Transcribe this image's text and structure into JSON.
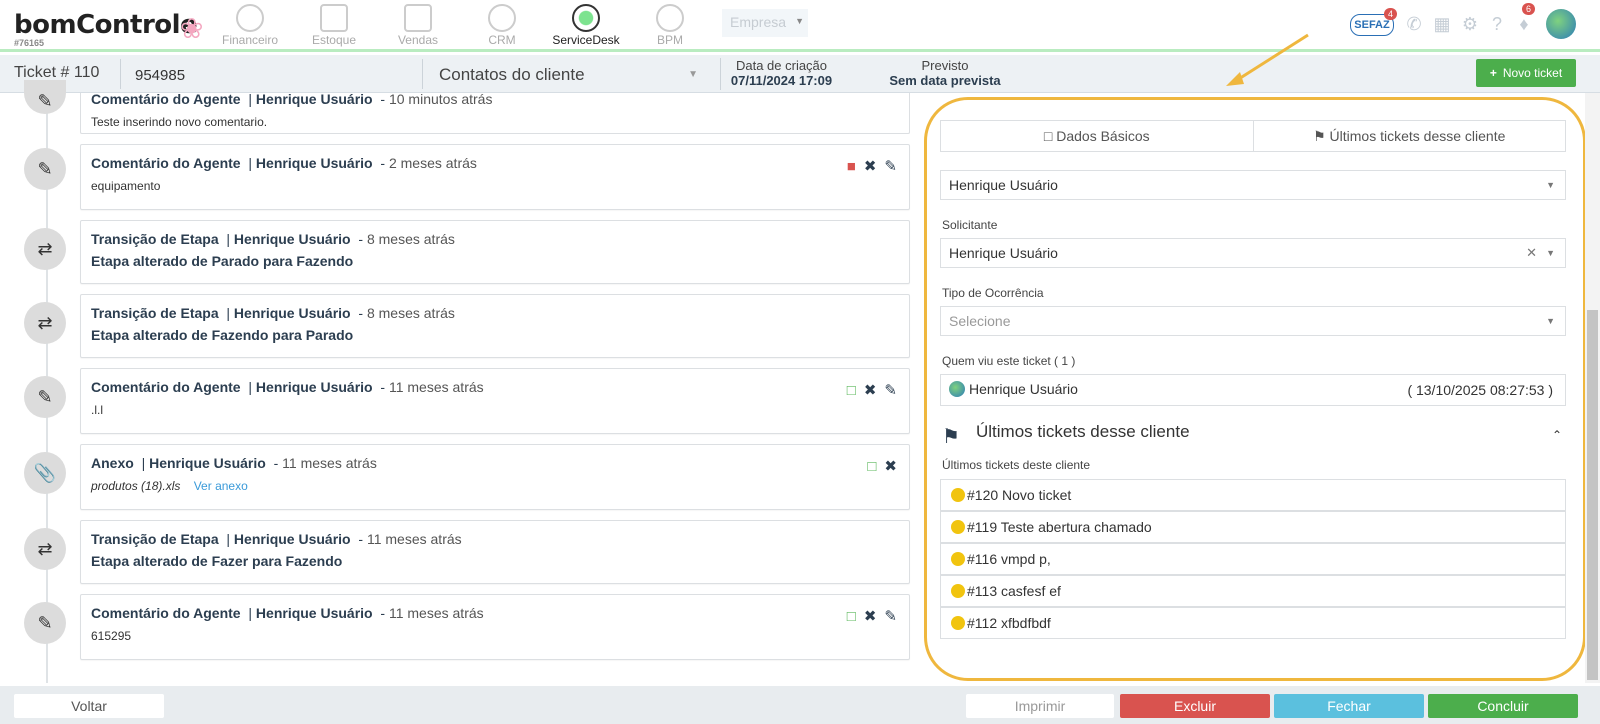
{
  "app": {
    "logo_text": "bomControle",
    "client_code": "#76165"
  },
  "nav": {
    "items": [
      {
        "label": "Financeiro"
      },
      {
        "label": "Estoque"
      },
      {
        "label": "Vendas"
      },
      {
        "label": "CRM"
      },
      {
        "label": "ServiceDesk"
      },
      {
        "label": "BPM"
      }
    ],
    "company_select": "Empresa",
    "sefaz_label": "SEFAZ",
    "sefaz_badge": "4",
    "notifications_badge": "6"
  },
  "ticket": {
    "number_label": "Ticket # 110",
    "id_value": "954985",
    "contacts_select": "Contatos do cliente",
    "created_label": "Data de criação",
    "created_value": "07/11/2024 17:09",
    "expected_label": "Previsto",
    "expected_value": "Sem data prevista",
    "new_button": "Novo ticket"
  },
  "timeline": [
    {
      "type": "Comentário do Agente",
      "user": "Henrique Usuário",
      "ago": "10 minutos atrás",
      "body": "Teste inserindo novo comentario."
    },
    {
      "type": "Comentário do Agente",
      "user": "Henrique Usuário",
      "ago": "2 meses atrás",
      "body": "equipamento"
    },
    {
      "type": "Transição de Etapa",
      "user": "Henrique Usuário",
      "ago": "8 meses atrás",
      "body": "Etapa alterado de Parado para Fazendo"
    },
    {
      "type": "Transição de Etapa",
      "user": "Henrique Usuário",
      "ago": "8 meses atrás",
      "body": "Etapa alterado de Fazendo para Parado"
    },
    {
      "type": "Comentário do Agente",
      "user": "Henrique Usuário",
      "ago": "11 meses atrás",
      "body": ".l.l"
    },
    {
      "type": "Anexo",
      "user": "Henrique Usuário",
      "ago": "11 meses atrás",
      "file": "produtos (18).xls",
      "link": "Ver anexo"
    },
    {
      "type": "Transição de Etapa",
      "user": "Henrique Usuário",
      "ago": "11 meses atrás",
      "body": "Etapa alterado de Fazer para Fazendo"
    },
    {
      "type": "Comentário do Agente",
      "user": "Henrique Usuário",
      "ago": "11 meses atrás",
      "body": "615295"
    }
  ],
  "panel": {
    "tabs": [
      "Dados Básicos",
      "Últimos tickets desse cliente"
    ],
    "responsavel_value": "Henrique Usuário",
    "solicitante_label": "Solicitante",
    "solicitante_value": "Henrique Usuário",
    "ocorrencia_label": "Tipo de Ocorrência",
    "ocorrencia_placeholder": "Selecione",
    "viewers_label": "Quem viu este ticket ( 1 )",
    "viewer_name": "Henrique Usuário",
    "viewer_time": "( 13/10/2025 08:27:53 )",
    "section_title": "Últimos tickets desse cliente",
    "list_label": "Últimos tickets deste cliente",
    "tickets": [
      "#120 Novo ticket",
      "#119 Teste abertura chamado",
      "#116 vmpd p,",
      "#113 casfesf ef",
      "#112 xfbdfbdf"
    ]
  },
  "footer": {
    "back": "Voltar",
    "print": "Imprimir",
    "delete": "Excluir",
    "close": "Fechar",
    "finish": "Concluir"
  },
  "colors": {
    "highlight": "#efb73e",
    "success": "#4cae4c",
    "danger": "#d9534f",
    "info": "#5bc0de",
    "ticket_dot": "#f1c40f"
  }
}
